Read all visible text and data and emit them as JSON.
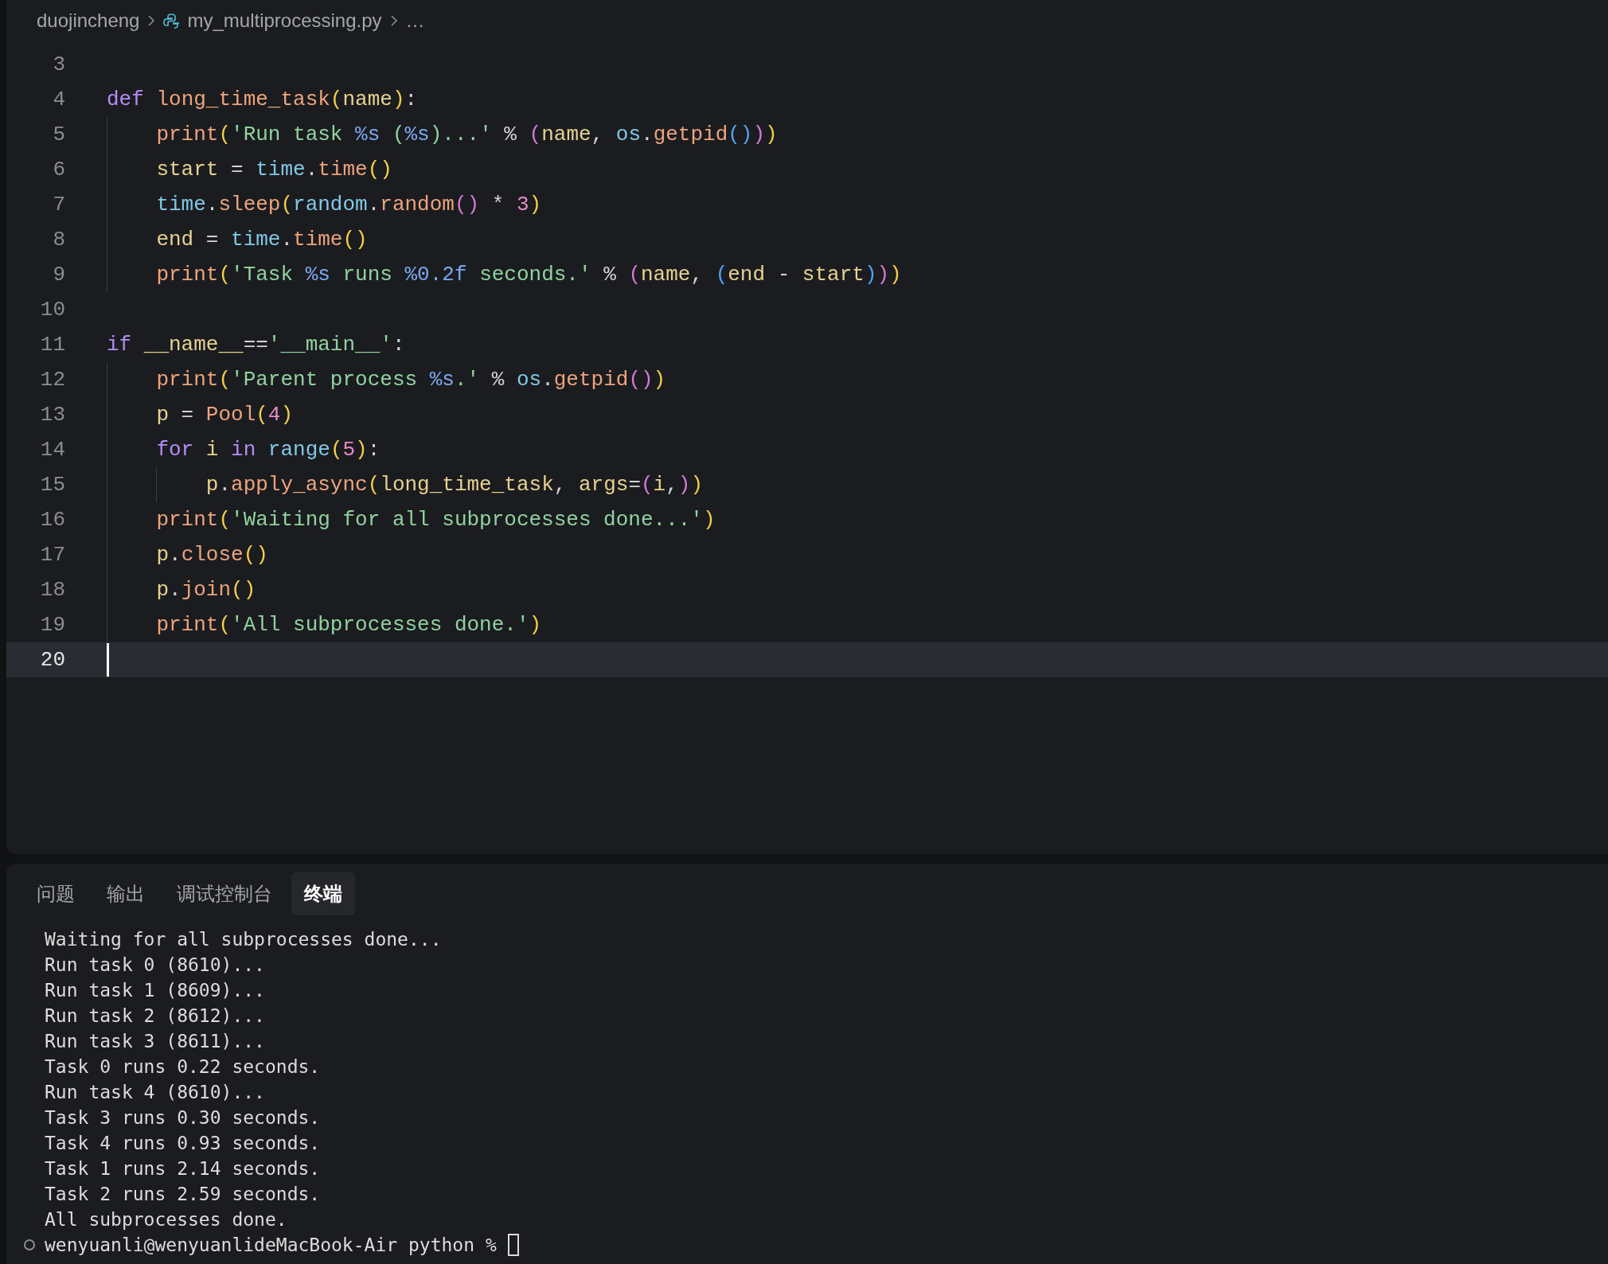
{
  "breadcrumb": [
    {
      "label": "duojincheng",
      "kind": "folder"
    },
    {
      "label": "my_multiprocessing.py",
      "kind": "file"
    },
    {
      "label": "…",
      "kind": "more"
    }
  ],
  "editor": {
    "lines": [
      {
        "number": "3",
        "current": false
      },
      {
        "number": "4",
        "current": false,
        "tokens": [
          {
            "t": "def ",
            "kind": "kw"
          },
          {
            "t": "long_time_task",
            "kind": "fn"
          },
          {
            "t": "(",
            "kind": "b1"
          },
          {
            "t": "name",
            "kind": "var"
          },
          {
            "t": ")",
            "kind": "b1"
          },
          {
            "t": ":",
            "kind": "op"
          }
        ]
      },
      {
        "number": "5",
        "current": false,
        "tokens": [
          {
            "t": "    print",
            "kind": "fn"
          },
          {
            "t": "(",
            "kind": "b1"
          },
          {
            "t": "'Run task ",
            "kind": "str"
          },
          {
            "t": "%s",
            "kind": "fmt"
          },
          {
            "t": " (",
            "kind": "str"
          },
          {
            "t": "%s",
            "kind": "fmt"
          },
          {
            "t": ")...'",
            "kind": "str"
          },
          {
            "t": " % ",
            "kind": "op"
          },
          {
            "t": "(",
            "kind": "b2"
          },
          {
            "t": "name",
            "kind": "var"
          },
          {
            "t": ", ",
            "kind": "op"
          },
          {
            "t": "os",
            "kind": "mod"
          },
          {
            "t": ".",
            "kind": "op"
          },
          {
            "t": "getpid",
            "kind": "fn"
          },
          {
            "t": "()",
            "kind": "b3"
          },
          {
            "t": ")",
            "kind": "b2"
          },
          {
            "t": ")",
            "kind": "b1"
          }
        ]
      },
      {
        "number": "6",
        "current": false,
        "tokens": [
          {
            "t": "    start",
            "kind": "var"
          },
          {
            "t": " = ",
            "kind": "op"
          },
          {
            "t": "time",
            "kind": "mod"
          },
          {
            "t": ".",
            "kind": "op"
          },
          {
            "t": "time",
            "kind": "fn"
          },
          {
            "t": "()",
            "kind": "b1"
          }
        ]
      },
      {
        "number": "7",
        "current": false,
        "tokens": [
          {
            "t": "    time",
            "kind": "mod"
          },
          {
            "t": ".",
            "kind": "op"
          },
          {
            "t": "sleep",
            "kind": "fn"
          },
          {
            "t": "(",
            "kind": "b1"
          },
          {
            "t": "random",
            "kind": "mod"
          },
          {
            "t": ".",
            "kind": "op"
          },
          {
            "t": "random",
            "kind": "fn"
          },
          {
            "t": "()",
            "kind": "b2"
          },
          {
            "t": " * ",
            "kind": "op"
          },
          {
            "t": "3",
            "kind": "num"
          },
          {
            "t": ")",
            "kind": "b1"
          }
        ]
      },
      {
        "number": "8",
        "current": false,
        "tokens": [
          {
            "t": "    end",
            "kind": "var"
          },
          {
            "t": " = ",
            "kind": "op"
          },
          {
            "t": "time",
            "kind": "mod"
          },
          {
            "t": ".",
            "kind": "op"
          },
          {
            "t": "time",
            "kind": "fn"
          },
          {
            "t": "()",
            "kind": "b1"
          }
        ]
      },
      {
        "number": "9",
        "current": false,
        "tokens": [
          {
            "t": "    print",
            "kind": "fn"
          },
          {
            "t": "(",
            "kind": "b1"
          },
          {
            "t": "'Task ",
            "kind": "str"
          },
          {
            "t": "%s",
            "kind": "fmt"
          },
          {
            "t": " runs ",
            "kind": "str"
          },
          {
            "t": "%0.2f",
            "kind": "fmt"
          },
          {
            "t": " seconds.'",
            "kind": "str"
          },
          {
            "t": " % ",
            "kind": "op"
          },
          {
            "t": "(",
            "kind": "b2"
          },
          {
            "t": "name",
            "kind": "var"
          },
          {
            "t": ", ",
            "kind": "op"
          },
          {
            "t": "(",
            "kind": "b3"
          },
          {
            "t": "end",
            "kind": "var"
          },
          {
            "t": " - ",
            "kind": "op"
          },
          {
            "t": "start",
            "kind": "var"
          },
          {
            "t": ")",
            "kind": "b3"
          },
          {
            "t": ")",
            "kind": "b2"
          },
          {
            "t": ")",
            "kind": "b1"
          }
        ]
      },
      {
        "number": "10",
        "current": false
      },
      {
        "number": "11",
        "current": false,
        "tokens": [
          {
            "t": "if ",
            "kind": "kw"
          },
          {
            "t": "__name__",
            "kind": "var"
          },
          {
            "t": "==",
            "kind": "op"
          },
          {
            "t": "'__main__'",
            "kind": "str"
          },
          {
            "t": ":",
            "kind": "op"
          }
        ]
      },
      {
        "number": "12",
        "current": false,
        "tokens": [
          {
            "t": "    print",
            "kind": "fn"
          },
          {
            "t": "(",
            "kind": "b1"
          },
          {
            "t": "'Parent process ",
            "kind": "str"
          },
          {
            "t": "%s",
            "kind": "fmt"
          },
          {
            "t": ".'",
            "kind": "str"
          },
          {
            "t": " % ",
            "kind": "op"
          },
          {
            "t": "os",
            "kind": "mod"
          },
          {
            "t": ".",
            "kind": "op"
          },
          {
            "t": "getpid",
            "kind": "fn"
          },
          {
            "t": "()",
            "kind": "b2"
          },
          {
            "t": ")",
            "kind": "b1"
          }
        ]
      },
      {
        "number": "13",
        "current": false,
        "tokens": [
          {
            "t": "    p",
            "kind": "var"
          },
          {
            "t": " = ",
            "kind": "op"
          },
          {
            "t": "Pool",
            "kind": "fn"
          },
          {
            "t": "(",
            "kind": "b1"
          },
          {
            "t": "4",
            "kind": "num"
          },
          {
            "t": ")",
            "kind": "b1"
          }
        ]
      },
      {
        "number": "14",
        "current": false,
        "tokens": [
          {
            "t": "    for ",
            "kind": "kw"
          },
          {
            "t": "i ",
            "kind": "var"
          },
          {
            "t": "in ",
            "kind": "kw"
          },
          {
            "t": "range",
            "kind": "mod"
          },
          {
            "t": "(",
            "kind": "b1"
          },
          {
            "t": "5",
            "kind": "num"
          },
          {
            "t": ")",
            "kind": "b1"
          },
          {
            "t": ":",
            "kind": "op"
          }
        ]
      },
      {
        "number": "15",
        "current": false,
        "tokens": [
          {
            "t": "        p",
            "kind": "var"
          },
          {
            "t": ".",
            "kind": "op"
          },
          {
            "t": "apply_async",
            "kind": "fn"
          },
          {
            "t": "(",
            "kind": "b1"
          },
          {
            "t": "long_time_task",
            "kind": "var"
          },
          {
            "t": ", ",
            "kind": "op"
          },
          {
            "t": "args",
            "kind": "var"
          },
          {
            "t": "=",
            "kind": "op"
          },
          {
            "t": "(",
            "kind": "b2"
          },
          {
            "t": "i",
            "kind": "var"
          },
          {
            "t": ",",
            "kind": "op"
          },
          {
            "t": ")",
            "kind": "b2"
          },
          {
            "t": ")",
            "kind": "b1"
          }
        ]
      },
      {
        "number": "16",
        "current": false,
        "tokens": [
          {
            "t": "    print",
            "kind": "fn"
          },
          {
            "t": "(",
            "kind": "b1"
          },
          {
            "t": "'Waiting for all subprocesses done...'",
            "kind": "str"
          },
          {
            "t": ")",
            "kind": "b1"
          }
        ]
      },
      {
        "number": "17",
        "current": false,
        "tokens": [
          {
            "t": "    p",
            "kind": "var"
          },
          {
            "t": ".",
            "kind": "op"
          },
          {
            "t": "close",
            "kind": "fn"
          },
          {
            "t": "()",
            "kind": "b1"
          }
        ]
      },
      {
        "number": "18",
        "current": false,
        "tokens": [
          {
            "t": "    p",
            "kind": "var"
          },
          {
            "t": ".",
            "kind": "op"
          },
          {
            "t": "join",
            "kind": "fn"
          },
          {
            "t": "()",
            "kind": "b1"
          }
        ]
      },
      {
        "number": "19",
        "current": false,
        "tokens": [
          {
            "t": "    print",
            "kind": "fn"
          },
          {
            "t": "(",
            "kind": "b1"
          },
          {
            "t": "'All subprocesses done.'",
            "kind": "str"
          },
          {
            "t": ")",
            "kind": "b1"
          }
        ]
      },
      {
        "number": "20",
        "current": true
      }
    ]
  },
  "panel_tabs": [
    {
      "label": "问题",
      "selected": false
    },
    {
      "label": "输出",
      "selected": false
    },
    {
      "label": "调试控制台",
      "selected": false
    },
    {
      "label": "终端",
      "selected": true
    }
  ],
  "terminal": {
    "lines": [
      "Waiting for all subprocesses done...",
      "Run task 0 (8610)...",
      "Run task 1 (8609)...",
      "Run task 2 (8612)...",
      "Run task 3 (8611)...",
      "Task 0 runs 0.22 seconds.",
      "Run task 4 (8610)...",
      "Task 3 runs 0.30 seconds.",
      "Task 4 runs 0.93 seconds.",
      "Task 1 runs 2.14 seconds.",
      "Task 2 runs 2.59 seconds.",
      "All subprocesses done."
    ],
    "prompt": "wenyuanli@wenyuanlideMacBook-Air python %"
  }
}
